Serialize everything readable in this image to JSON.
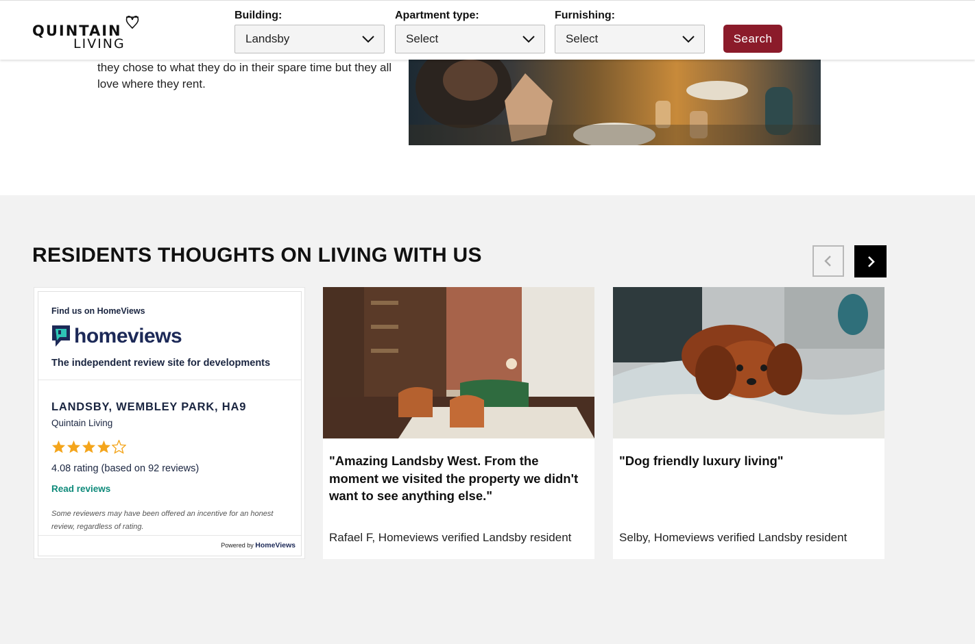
{
  "header": {
    "logo_top": "QUINTAIN",
    "logo_bottom": "LIVING",
    "filters": [
      {
        "label": "Building:",
        "value": "Landsby"
      },
      {
        "label": "Apartment type:",
        "value": "Select"
      },
      {
        "label": "Furnishing:",
        "value": "Select"
      }
    ],
    "search_label": "Search",
    "accent_color": "#8b1b2a"
  },
  "intro": {
    "text": "they chose to what they do in their spare time but they all love where they rent."
  },
  "reviews": {
    "title": "RESIDENTS THOUGHTS ON LIVING WITH US",
    "homeviews": {
      "find_label": "Find us on HomeViews",
      "brand": "homeviews",
      "tagline": "The independent review site for developments",
      "development": "LANDSBY, WEMBLEY PARK, HA9",
      "company": "Quintain Living",
      "stars": 4,
      "stars_max": 5,
      "rating_text": "4.08 rating (based on 92 reviews)",
      "read_reviews": "Read reviews",
      "note": "Some reviewers may have been offered an incentive for an honest review, regardless of rating.",
      "powered_prefix": "Powered by",
      "powered_brand": "HomeViews",
      "brand_color": "#1c2957",
      "link_color": "#0e8a7a"
    },
    "testimonials": [
      {
        "quote": "\"Amazing Landsby West. From the moment we visited the property we didn't want to see anything else.\"",
        "author": "Rafael F, Homeviews verified Landsby resident",
        "image": "living-room-photo"
      },
      {
        "quote": "\"Dog friendly luxury living\"",
        "author": "Selby, Homeviews verified Landsby resident",
        "image": "dog-on-bed-photo"
      }
    ]
  }
}
